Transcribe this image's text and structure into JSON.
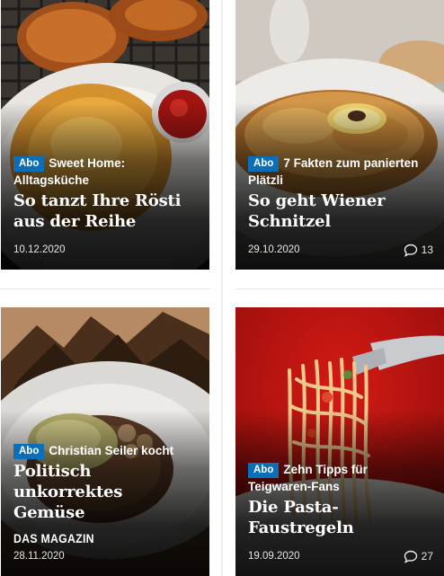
{
  "articles": [
    {
      "abo": "Abo",
      "kicker": "Sweet Home: Alltagsküche",
      "headline": "So tanzt Ihre Rösti aus der Reihe",
      "date": "10.12.2020",
      "comments": ""
    },
    {
      "abo": "Abo",
      "kicker": "7 Fakten zum panierten Plätzli",
      "headline": "So geht Wiener Schnitzel",
      "date": "29.10.2020",
      "comments": "13"
    },
    {
      "abo": "Abo",
      "kicker": "Christian Seiler kocht",
      "headline": "Politisch unkorrektes Gemüse",
      "section": "DAS MAGAZIN",
      "date": "28.11.2020",
      "comments": ""
    },
    {
      "abo": "Abo",
      "kicker": "Zehn Tipps für Teigwaren-Fans",
      "headline": "Die Pasta-Faustregeln",
      "date": "19.09.2020",
      "comments": "27"
    }
  ],
  "colors": {
    "abo_badge": "#0a6fb8",
    "overlay": "#000000"
  },
  "icons": {
    "comment": "comment-bubble-icon"
  }
}
